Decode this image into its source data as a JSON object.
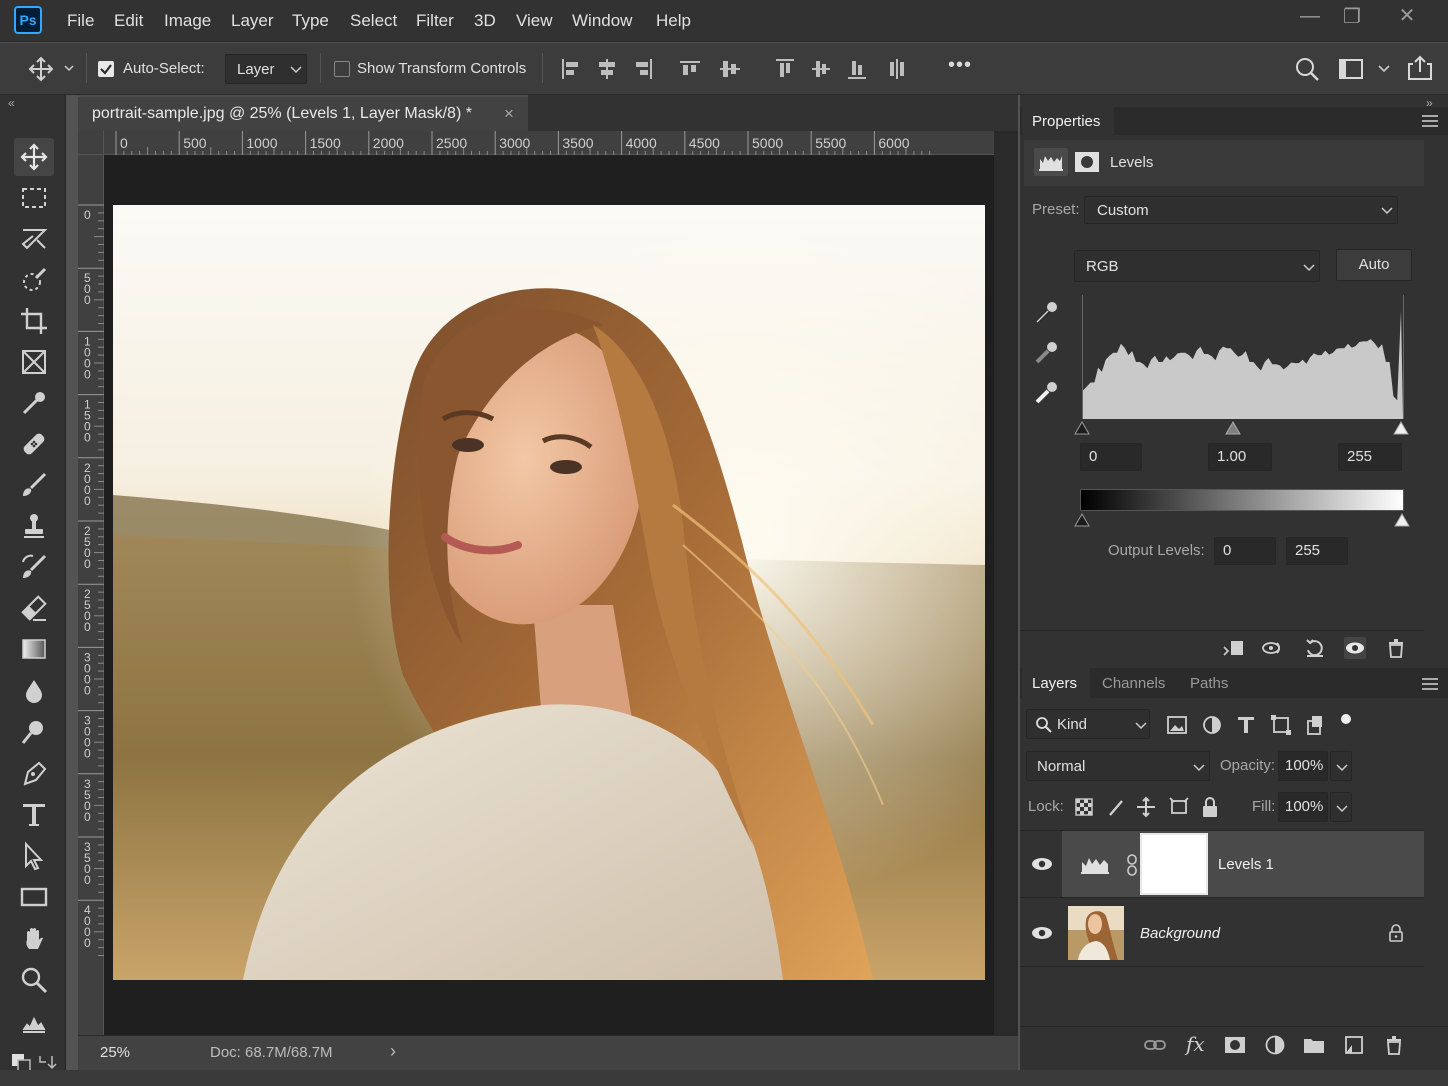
{
  "app": {
    "logo": "Ps"
  },
  "menubar": {
    "items": [
      "File",
      "Edit",
      "Image",
      "Layer",
      "Type",
      "Select",
      "Filter",
      "3D",
      "View",
      "Window",
      "Help"
    ],
    "window_controls": {
      "minimize": "—",
      "restore": "❐",
      "close": "✕"
    }
  },
  "options": {
    "auto_select_label": "Auto-Select:",
    "auto_select_checked": true,
    "auto_select_target": "Layer",
    "show_transform_label": "Show Transform Controls",
    "show_transform_checked": false,
    "more": "•••"
  },
  "document": {
    "tab_title": "portrait-sample.jpg @ 25% (Levels 1, Layer Mask/8) *",
    "close": "×",
    "ruler_h": [
      "0",
      "500",
      "1000",
      "1500",
      "2000",
      "2500",
      "3000",
      "3500",
      "4000",
      "4500",
      "5000",
      "5500",
      "6000"
    ],
    "ruler_v": [
      "0",
      "5 0 0",
      "1 0 0 0",
      "1 5 0 0",
      "2 0 0 0",
      "2 5 0 0",
      "2 5 0 0",
      "3 0 0 0",
      "3 0 0 0",
      "3 5 0 0",
      "3 5 0 0",
      "4 0 0 0"
    ],
    "image_description_icon": "portrait-photo",
    "zoom": "25%",
    "doc_size": "Doc: 68.7M/68.7M",
    "status_arrow": "›"
  },
  "tools": [
    "move-tool",
    "marquee-tool",
    "lasso-tool",
    "quick-select-tool",
    "crop-tool",
    "frame-tool",
    "eyedropper-tool",
    "healing-tool",
    "brush-tool",
    "stamp-tool",
    "history-brush-tool",
    "eraser-tool",
    "gradient-tool",
    "blur-tool",
    "dodge-tool",
    "pen-tool",
    "type-tool",
    "path-select-tool",
    "rectangle-tool",
    "hand-tool",
    "zoom-tool",
    "edit-toolbar",
    "swap-colors"
  ],
  "properties": {
    "tab": "Properties",
    "adjustment_name": "Levels",
    "preset_label": "Preset:",
    "preset_value": "Custom",
    "channel": "RGB",
    "auto_button": "Auto",
    "input_black": "0",
    "input_gamma": "1.00",
    "input_white": "255",
    "output_label": "Output Levels:",
    "output_black": "0",
    "output_white": "255",
    "histogram": [
      0.25,
      0.32,
      0.45,
      0.52,
      0.58,
      0.66,
      0.56,
      0.5,
      0.48,
      0.52,
      0.5,
      0.55,
      0.54,
      0.58,
      0.56,
      0.6,
      0.57,
      0.55,
      0.6,
      0.62,
      0.58,
      0.56,
      0.5,
      0.46,
      0.5,
      0.48,
      0.47,
      0.46,
      0.49,
      0.52,
      0.54,
      0.56,
      0.6,
      0.58,
      0.62,
      0.66,
      0.64,
      0.68,
      0.7,
      0.62,
      0.5,
      0.2,
      0.95
    ]
  },
  "layers_panel": {
    "tabs": [
      "Layers",
      "Channels",
      "Paths"
    ],
    "active_tab": "Layers",
    "filter_label": "Kind",
    "blend_mode": "Normal",
    "opacity_label": "Opacity:",
    "opacity": "100%",
    "lock_label": "Lock:",
    "fill_label": "Fill:",
    "fill": "100%",
    "layers": [
      {
        "name": "Levels 1",
        "selected": true,
        "visible": true
      },
      {
        "name": "Background",
        "selected": false,
        "visible": true,
        "locked": true
      }
    ]
  },
  "colors": {
    "accent": "#31a8ff",
    "menubar": "#323232",
    "panel": "#323232",
    "pasteboard": "#1f1f1f"
  }
}
